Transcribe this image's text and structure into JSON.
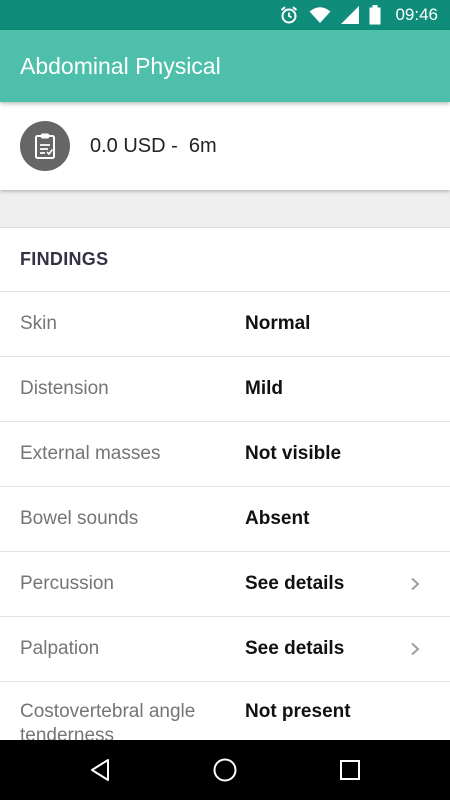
{
  "status_bar": {
    "time": "09:46",
    "icons": [
      "alarm-icon",
      "wifi-icon",
      "signal-icon",
      "battery-icon"
    ]
  },
  "app_bar": {
    "title": "Abdominal Physical"
  },
  "summary": {
    "icon": "clipboard-icon",
    "text": "0.0 USD -  6m"
  },
  "findings": {
    "header": "FINDINGS",
    "rows": [
      {
        "label": "Skin",
        "value": "Normal"
      },
      {
        "label": "Distension",
        "value": "Mild"
      },
      {
        "label": "External masses",
        "value": "Not visible"
      },
      {
        "label": "Bowel sounds",
        "value": "Absent"
      },
      {
        "label": "Percussion",
        "value": "See details"
      },
      {
        "label": "Palpation",
        "value": "See details"
      },
      {
        "label": "Costovertebral angle tenderness",
        "value": "Not present"
      }
    ]
  },
  "nav_bar": {
    "buttons": [
      "back-icon",
      "home-icon",
      "recents-icon"
    ]
  },
  "colors": {
    "status_bar": "#0f8c7a",
    "app_bar": "#4dbfab",
    "background": "#eeeeee"
  }
}
